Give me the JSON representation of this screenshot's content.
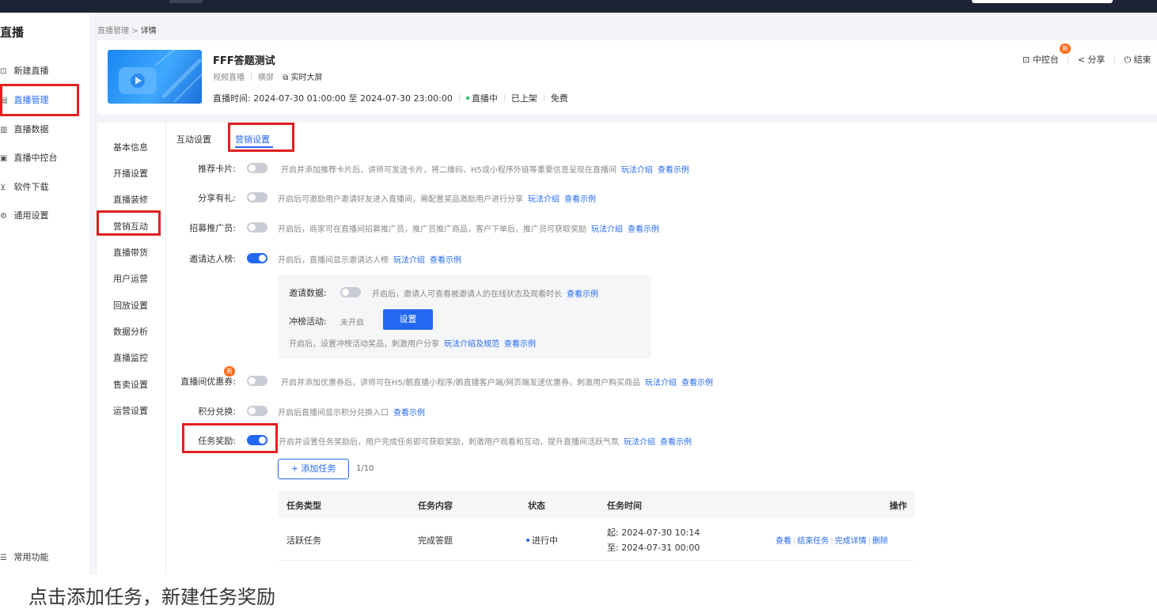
{
  "sidebar": {
    "title": "直播",
    "items": [
      {
        "label": "新建直播",
        "icon": "plus-screen-icon"
      },
      {
        "label": "直播管理",
        "icon": "list-screen-icon",
        "active": true
      },
      {
        "label": "直播数据",
        "icon": "chart-screen-icon"
      },
      {
        "label": "直播中控台",
        "icon": "monitor-icon"
      },
      {
        "label": "软件下载",
        "icon": "download-icon"
      },
      {
        "label": "通用设置",
        "icon": "gear-icon"
      }
    ],
    "footer": "常用功能"
  },
  "breadcrumb": {
    "parent": "直播管理",
    "separator": ">",
    "current": "详情"
  },
  "live": {
    "title": "FFF答题测试",
    "type": "视频直播",
    "orientation": "横屏",
    "big_screen": "实时大屏",
    "time_label": "直播时间:",
    "time_range": "2024-07-30 01:00:00 至 2024-07-30 23:00:00",
    "status": "直播中",
    "shelf": "已上架",
    "price": "免费"
  },
  "header_actions": {
    "console": "中控台",
    "new_badge": "新",
    "share": "分享",
    "end": "结束"
  },
  "sub_nav": [
    "基本信息",
    "开播设置",
    "直播装修",
    "营销互动",
    "直播带货",
    "用户运营",
    "回放设置",
    "数据分析",
    "直播监控",
    "售卖设置",
    "运营设置"
  ],
  "tabs": [
    "互动设置",
    "营销设置"
  ],
  "settings": [
    {
      "label": "推荐卡片:",
      "on": false,
      "desc": "开启并添加推荐卡片后，讲师可发送卡片，将二维码、H5或小程序外链等重要信息呈现在直播间",
      "links": [
        "玩法介绍",
        "查看示例"
      ]
    },
    {
      "label": "分享有礼:",
      "on": false,
      "desc": "开启后可激励用户邀请好友进入直播间，需配置奖品激励用户进行分享",
      "links": [
        "玩法介绍",
        "查看示例"
      ]
    },
    {
      "label": "招募推广员:",
      "on": false,
      "desc": "开启后，商家可在直播间招募推广员，推广员推广商品，客户下单后，推广员可获取奖励",
      "links": [
        "玩法介绍",
        "查看示例"
      ]
    },
    {
      "label": "邀请达人榜:",
      "on": true,
      "desc": "开启后，直播间显示邀请达人榜",
      "links": [
        "玩法介绍",
        "查看示例"
      ]
    },
    {
      "label": "直播间优惠券:",
      "on": false,
      "badge": "新",
      "desc": "开启并添加优惠券后，讲师可在H5/鹅直播小程序/鹅直播客户端/网页端发送优惠券，刺激用户购买商品",
      "links": [
        "玩法介绍",
        "查看示例"
      ]
    },
    {
      "label": "积分兑换:",
      "on": false,
      "desc": "开启后直播间显示积分兑换入口",
      "links": [
        "查看示例"
      ]
    },
    {
      "label": "任务奖励:",
      "on": true,
      "desc": "开启并设置任务奖励后，用户完成任务即可获取奖励，刺激用户观看和互动，提升直播间活跃气氛",
      "links": [
        "玩法介绍",
        "查看示例"
      ]
    }
  ],
  "invite_panel": {
    "data_label": "邀请数据:",
    "data_on": false,
    "data_desc": "开启后，邀请人可查看被邀请人的在线状态及观看时长",
    "data_link": "查看示例",
    "rank_label": "冲榜活动:",
    "rank_status": "未开启",
    "rank_button": "设置",
    "rank_desc": "开启后，设置冲榜活动奖品，刺激用户分享",
    "rank_links": [
      "玩法介绍及规范",
      "查看示例"
    ]
  },
  "tasks": {
    "add_button": "+ 添加任务",
    "count": "1/10",
    "columns": [
      "任务类型",
      "任务内容",
      "状态",
      "任务时间",
      "操作"
    ],
    "rows": [
      {
        "type": "活跃任务",
        "content": "完成答题",
        "status": "进行中",
        "start": "起: 2024-07-30 10:14",
        "end": "至: 2024-07-31 00:00",
        "ops": [
          "查看",
          "结束任务",
          "完成详情",
          "删除"
        ]
      }
    ]
  },
  "caption": "点击添加任务，新建任务奖励",
  "colors": {
    "accent": "#2468f2",
    "highlight": "#e02020",
    "topbar": "#1d2235"
  }
}
